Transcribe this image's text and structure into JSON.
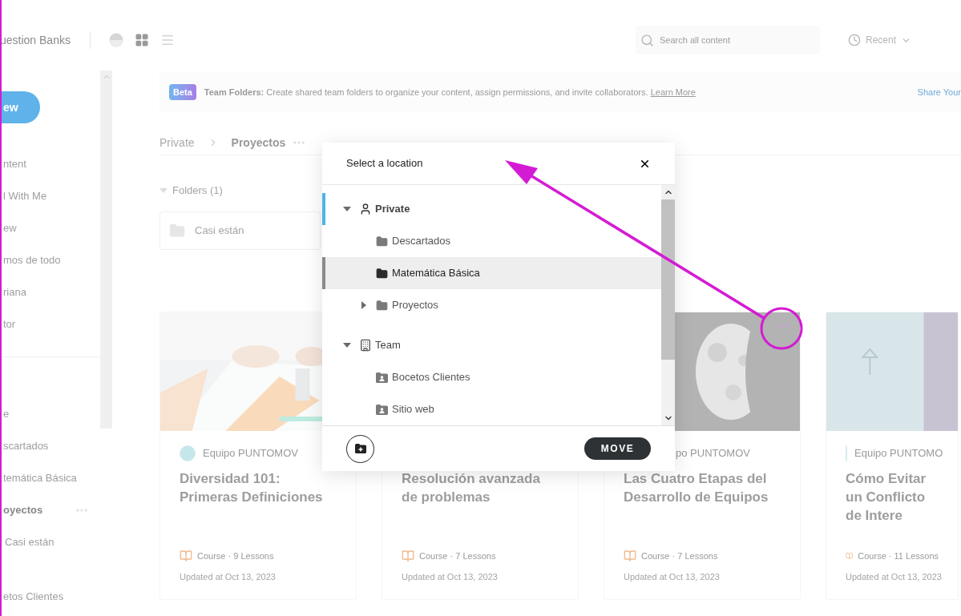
{
  "top_bar": {
    "title": "uestion Banks",
    "views": [
      {
        "kind": "grid",
        "selected": true
      },
      {
        "kind": "list",
        "selected": false
      }
    ],
    "search": {
      "placeholder": "Search all content"
    },
    "sort": {
      "label": "Recent"
    }
  },
  "sidebar": {
    "new_button": "ew",
    "items": [
      {
        "label": "ntent",
        "selected": false
      },
      {
        "label": "l With Me",
        "selected": false
      },
      {
        "label": "ew",
        "selected": false
      },
      {
        "label": "mos de todo",
        "selected": false
      },
      {
        "label": "riana",
        "selected": false
      },
      {
        "label": "tor",
        "selected": false
      }
    ],
    "folders": [
      {
        "label": "e",
        "selected": false
      },
      {
        "label": "scartados",
        "selected": false
      },
      {
        "label": "temática Básica",
        "selected": false
      },
      {
        "label": "oyectos",
        "selected": true
      },
      {
        "label": "Casi están",
        "selected": false
      },
      {
        "label": "etos Clientes",
        "selected": false
      }
    ]
  },
  "banner": {
    "badge": "Beta",
    "text": "**Team Folders:** Create shared team folders to organize your content, assign permissions, and invite collaborators.",
    "link": "Learn More",
    "action": "Share Your"
  },
  "breadcrumb": [
    {
      "label": "Private"
    },
    {
      "label": "Proyectos"
    }
  ],
  "folders": {
    "heading": "Folders (1)",
    "expanded": true,
    "items": [
      {
        "name": "Casi están"
      }
    ]
  },
  "cards": [
    {
      "avatar": true,
      "author": "Equipo PUNTOMOV",
      "title": "Diversidad 101: Primeras Definiciones",
      "meta": "Course · 9 Lessons",
      "updated": "Updated at Oct 13, 2023"
    },
    {
      "title": "Resolución avanzada de problemas",
      "meta": "Course · 7 Lessons",
      "updated": "Updated at Oct 13, 2023"
    },
    {
      "avatar": false,
      "author": "po PUNTOMOV",
      "title": "Las Cuatro Etapas del Desarrollo de Equipos",
      "meta": "Course · 7 Lessons",
      "updated": "Updated at Oct 13, 2023"
    },
    {
      "avatar": true,
      "author": "Equipo PUNTOMO",
      "title": "Cómo Evitar un Conflicto de Intere",
      "meta": "Course · 11 Lessons",
      "updated": "Updated at Oct 13, 2023"
    }
  ],
  "dialog": {
    "title": "Select a location",
    "button": "MOVE",
    "tree": [
      {
        "label": "Private",
        "kind": "person",
        "expanded": true,
        "current": true,
        "selected": false,
        "children": [
          {
            "label": "Descartados",
            "kind": "folder",
            "current": false,
            "selected": false
          },
          {
            "label": "Matemática Básica",
            "kind": "folder",
            "current": false,
            "selected": true
          },
          {
            "label": "Proyectos",
            "kind": "folder",
            "expanded": false,
            "current": false,
            "selected": false
          }
        ]
      },
      {
        "label": "Team",
        "kind": "team",
        "expanded": true,
        "current": false,
        "selected": false,
        "children": [
          {
            "label": "Bocetos Clientes",
            "kind": "shared",
            "current": false,
            "selected": false
          },
          {
            "label": "Sitio web",
            "kind": "shared",
            "current": false,
            "selected": false
          }
        ]
      }
    ]
  }
}
